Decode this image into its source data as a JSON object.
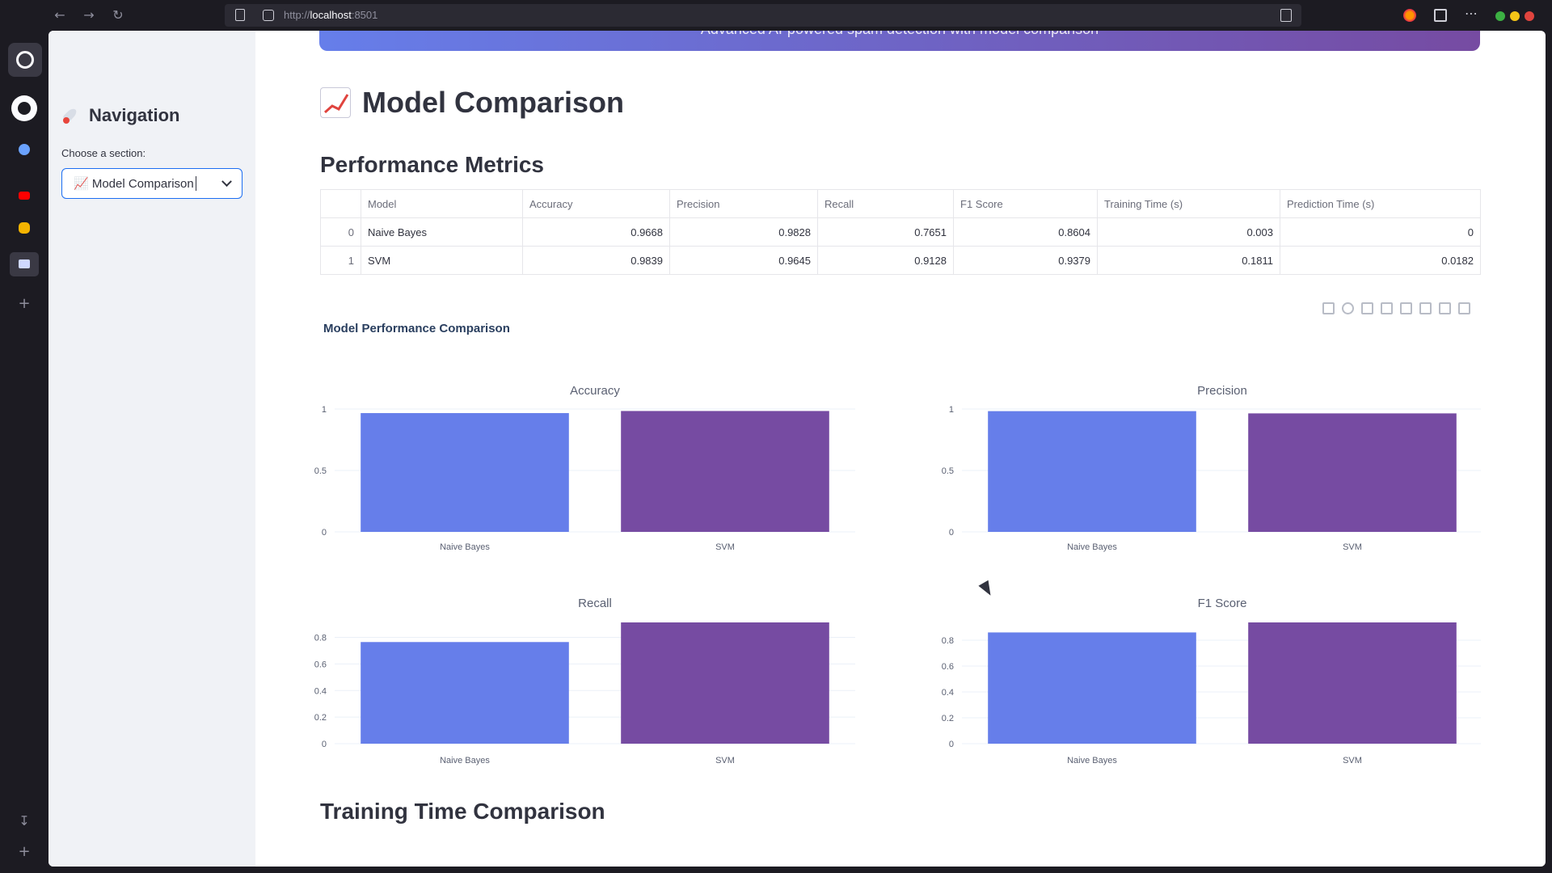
{
  "browser": {
    "url_prefix": "http://",
    "url_host": "localhost",
    "url_port": ":8501"
  },
  "sidebar": {
    "title": "Navigation",
    "select_label": "Choose a section:",
    "select_value": "📈 Model Comparison"
  },
  "main": {
    "banner_text": "Advanced AI-powered spam detection with model comparison",
    "page_title": "Model Comparison",
    "metrics_heading": "Performance Metrics",
    "chart_heading": "Model Performance Comparison",
    "training_heading": "Training Time Comparison"
  },
  "table": {
    "headers": [
      "",
      "Model",
      "Accuracy",
      "Precision",
      "Recall",
      "F1 Score",
      "Training Time (s)",
      "Prediction Time (s)"
    ],
    "rows": [
      [
        "0",
        "Naive Bayes",
        "0.9668",
        "0.9828",
        "0.7651",
        "0.8604",
        "0.003",
        "0"
      ],
      [
        "1",
        "SVM",
        "0.9839",
        "0.9645",
        "0.9128",
        "0.9379",
        "0.1811",
        "0.0182"
      ]
    ]
  },
  "colors": {
    "naive_bayes": "#667eea",
    "svm": "#764ba2"
  },
  "chart_data": [
    {
      "type": "bar",
      "title": "Accuracy",
      "categories": [
        "Naive Bayes",
        "SVM"
      ],
      "values": [
        0.9668,
        0.9839
      ],
      "yticks": [
        "0",
        "0.5",
        "1"
      ],
      "ylim": [
        0,
        1
      ]
    },
    {
      "type": "bar",
      "title": "Precision",
      "categories": [
        "Naive Bayes",
        "SVM"
      ],
      "values": [
        0.9828,
        0.9645
      ],
      "yticks": [
        "0",
        "0.5",
        "1"
      ],
      "ylim": [
        0,
        1
      ]
    },
    {
      "type": "bar",
      "title": "Recall",
      "categories": [
        "Naive Bayes",
        "SVM"
      ],
      "values": [
        0.7651,
        0.9128
      ],
      "yticks": [
        "0",
        "0.2",
        "0.4",
        "0.6",
        "0.8"
      ],
      "ylim": [
        0,
        0.9128
      ]
    },
    {
      "type": "bar",
      "title": "F1 Score",
      "categories": [
        "Naive Bayes",
        "SVM"
      ],
      "values": [
        0.8604,
        0.9379
      ],
      "yticks": [
        "0",
        "0.2",
        "0.4",
        "0.6",
        "0.8"
      ],
      "ylim": [
        0,
        0.9379
      ]
    }
  ]
}
